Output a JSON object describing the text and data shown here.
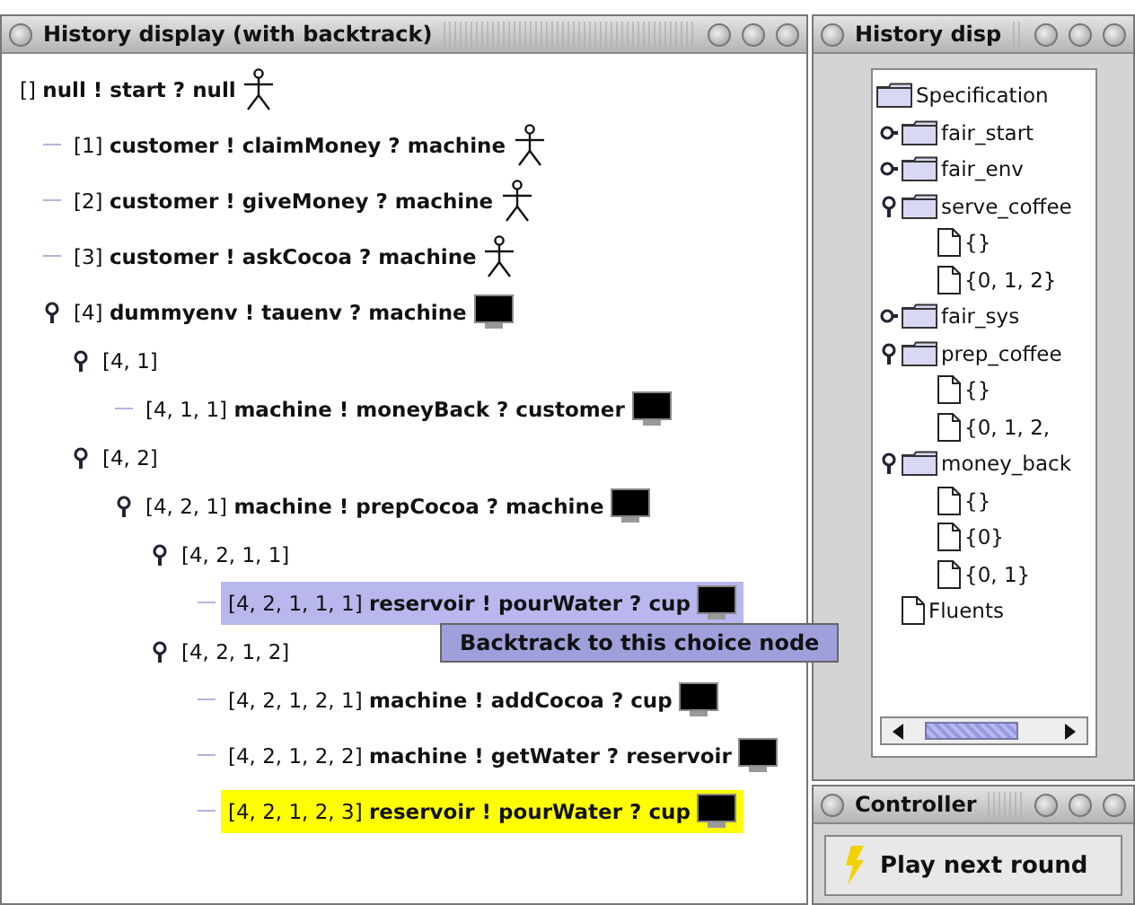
{
  "history": {
    "title": "History display (with backtrack)",
    "root": {
      "path": "[]",
      "event": "null ! start ? null",
      "kind": "actor",
      "selected": false,
      "hovered": false,
      "children": [
        {
          "path": "[1]",
          "event": "customer ! claimMoney ? machine",
          "kind": "actor",
          "selected": false,
          "hovered": false
        },
        {
          "path": "[2]",
          "event": "customer ! giveMoney ? machine",
          "kind": "actor",
          "selected": false,
          "hovered": false
        },
        {
          "path": "[3]",
          "event": "customer ! askCocoa ? machine",
          "kind": "actor",
          "selected": false,
          "hovered": false
        },
        {
          "path": "[4]",
          "event": "dummyenv ! tauenv ? machine",
          "kind": "machine",
          "selected": false,
          "hovered": false,
          "expanded": true,
          "children": [
            {
              "path": "[4, 1]",
              "selected": false,
              "hovered": false,
              "expanded": true,
              "children": [
                {
                  "path": "[4, 1, 1]",
                  "event": "machine ! moneyBack ? customer",
                  "kind": "machine",
                  "selected": false,
                  "hovered": false
                }
              ]
            },
            {
              "path": "[4, 2]",
              "selected": false,
              "hovered": false,
              "expanded": true,
              "children": [
                {
                  "path": "[4, 2, 1]",
                  "event": "machine ! prepCocoa ? machine",
                  "kind": "machine",
                  "selected": false,
                  "hovered": false,
                  "expanded": true,
                  "children": [
                    {
                      "path": "[4, 2, 1, 1]",
                      "selected": false,
                      "hovered": false,
                      "expanded": true,
                      "children": [
                        {
                          "path": "[4, 2, 1, 1, 1]",
                          "event": "reservoir ! pourWater ? cup",
                          "kind": "machine",
                          "selected": false,
                          "hovered": true
                        }
                      ]
                    },
                    {
                      "path": "[4, 2, 1, 2]",
                      "selected": false,
                      "hovered": false,
                      "expanded": true,
                      "children": [
                        {
                          "path": "[4, 2, 1, 2, 1]",
                          "event": "machine ! addCocoa ? cup",
                          "kind": "machine",
                          "selected": false,
                          "hovered": false
                        },
                        {
                          "path": "[4, 2, 1, 2, 2]",
                          "event": "machine ! getWater ? reservoir",
                          "kind": "machine",
                          "selected": false,
                          "hovered": false
                        },
                        {
                          "path": "[4, 2, 1, 2, 3]",
                          "event": "reservoir ! pourWater ? cup",
                          "kind": "machine",
                          "selected": true,
                          "hovered": false
                        }
                      ]
                    }
                  ]
                }
              ]
            }
          ]
        }
      ]
    },
    "context_menu": {
      "items": [
        "Backtrack to this choice node"
      ]
    }
  },
  "spec": {
    "title": "History disp",
    "root": {
      "label": "Specification",
      "kind": "folder",
      "children": [
        {
          "label": "fair_start",
          "kind": "folder",
          "expanded": false
        },
        {
          "label": "fair_env",
          "kind": "folder",
          "expanded": false
        },
        {
          "label": "serve_coffee",
          "kind": "folder",
          "expanded": true,
          "children": [
            {
              "label": "{}",
              "kind": "file"
            },
            {
              "label": "{0, 1, 2}",
              "kind": "file"
            }
          ]
        },
        {
          "label": "fair_sys",
          "kind": "folder",
          "expanded": false
        },
        {
          "label": "prep_coffee",
          "kind": "folder",
          "expanded": true,
          "children": [
            {
              "label": "{}",
              "kind": "file"
            },
            {
              "label": "{0, 1, 2, ",
              "kind": "file"
            }
          ]
        },
        {
          "label": "money_back",
          "kind": "folder",
          "expanded": true,
          "children": [
            {
              "label": "{}",
              "kind": "file"
            },
            {
              "label": "{0}",
              "kind": "file"
            },
            {
              "label": "{0, 1}",
              "kind": "file"
            }
          ]
        },
        {
          "label": "Fluents",
          "kind": "file"
        }
      ]
    }
  },
  "controller": {
    "title": "Controller",
    "button": "Play next round"
  }
}
